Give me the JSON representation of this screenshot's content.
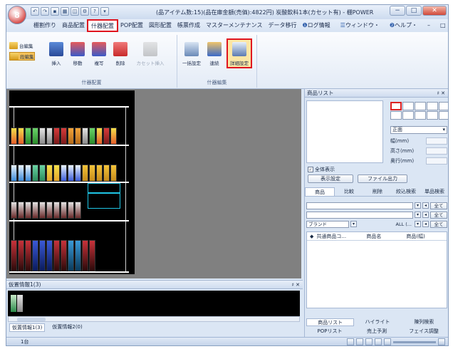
{
  "window": {
    "title": "(品アイテム数:15)(品在庫金額(売価):4822円) 炭酸飲料1本(カセット有) - 棚POWER",
    "app_badge": "8",
    "qat_icons": [
      "undo-icon",
      "redo-icon",
      "save-icon",
      "print-icon",
      "print-preview-icon",
      "settings-icon",
      "help-icon",
      "more-icon"
    ],
    "minimize": "−",
    "maximize": "□",
    "close": "✕"
  },
  "menu": {
    "tabs": [
      "棚割作り",
      "商品配置",
      "什器配置",
      "POP配置",
      "図形配置",
      "帳票作成",
      "マスターメンテナンス",
      "データ移行"
    ],
    "active_index": 2,
    "right_items": [
      "ログ情報",
      "ウィンドウ・",
      "ヘルプ・"
    ],
    "right_controls": [
      "–",
      "□",
      "✕"
    ]
  },
  "ribbon": {
    "group1": {
      "label": "什器配置",
      "small_buttons": [
        "台編集",
        "段編集"
      ],
      "buttons": [
        {
          "label": "挿入",
          "icon": "insert-icon",
          "disabled": false
        },
        {
          "label": "移動",
          "icon": "move-icon",
          "disabled": false
        },
        {
          "label": "複写",
          "icon": "copy-icon",
          "disabled": false
        },
        {
          "label": "削除",
          "icon": "delete-icon",
          "disabled": false
        },
        {
          "label": "カセット挿入",
          "icon": "cassette-insert-icon",
          "disabled": true
        }
      ]
    },
    "group2": {
      "label": "什器編集",
      "buttons": [
        {
          "label": "一括設定",
          "icon": "bulk-settings-icon",
          "disabled": false
        },
        {
          "label": "連続",
          "icon": "sequence-icon",
          "disabled": false
        },
        {
          "label": "詳細設定",
          "icon": "detail-settings-icon",
          "disabled": false
        }
      ]
    }
  },
  "product_panel": {
    "title": "商品リスト",
    "pin": "♯ ✕",
    "face_select": "正面",
    "dims": [
      {
        "label": "幅(mm)"
      },
      {
        "label": "高さ(mm)"
      },
      {
        "label": "奥行(mm)"
      }
    ],
    "show_all_label": "全体表示",
    "show_all_checked": "✓",
    "buttons": [
      "表示設定",
      "ファイル出力"
    ],
    "tabs": [
      "商品",
      "比較",
      "削除",
      "絞込検索",
      "単品検索"
    ],
    "filters": [
      {
        "value": "",
        "button": "全て"
      },
      {
        "value": "",
        "button": "全て"
      },
      {
        "value": "ブランド",
        "extra": "ALL (...",
        "button": "全て"
      }
    ],
    "list_columns": [
      "◆",
      "共通商品コ...",
      "商品名",
      "商品(幅)"
    ],
    "bottom_tabs_row1": [
      "商品リスト",
      "ハイライト",
      "陳列検索"
    ],
    "bottom_tabs_row2": [
      "POPリスト",
      "売上予測",
      "フェイス調整"
    ]
  },
  "temp_panel": {
    "title": "仮置情報1(3)",
    "pin": "♯ ✕",
    "tabs": [
      "仮置情報1(3)",
      "仮置情報2(0)"
    ]
  },
  "status": {
    "left": "1台"
  }
}
